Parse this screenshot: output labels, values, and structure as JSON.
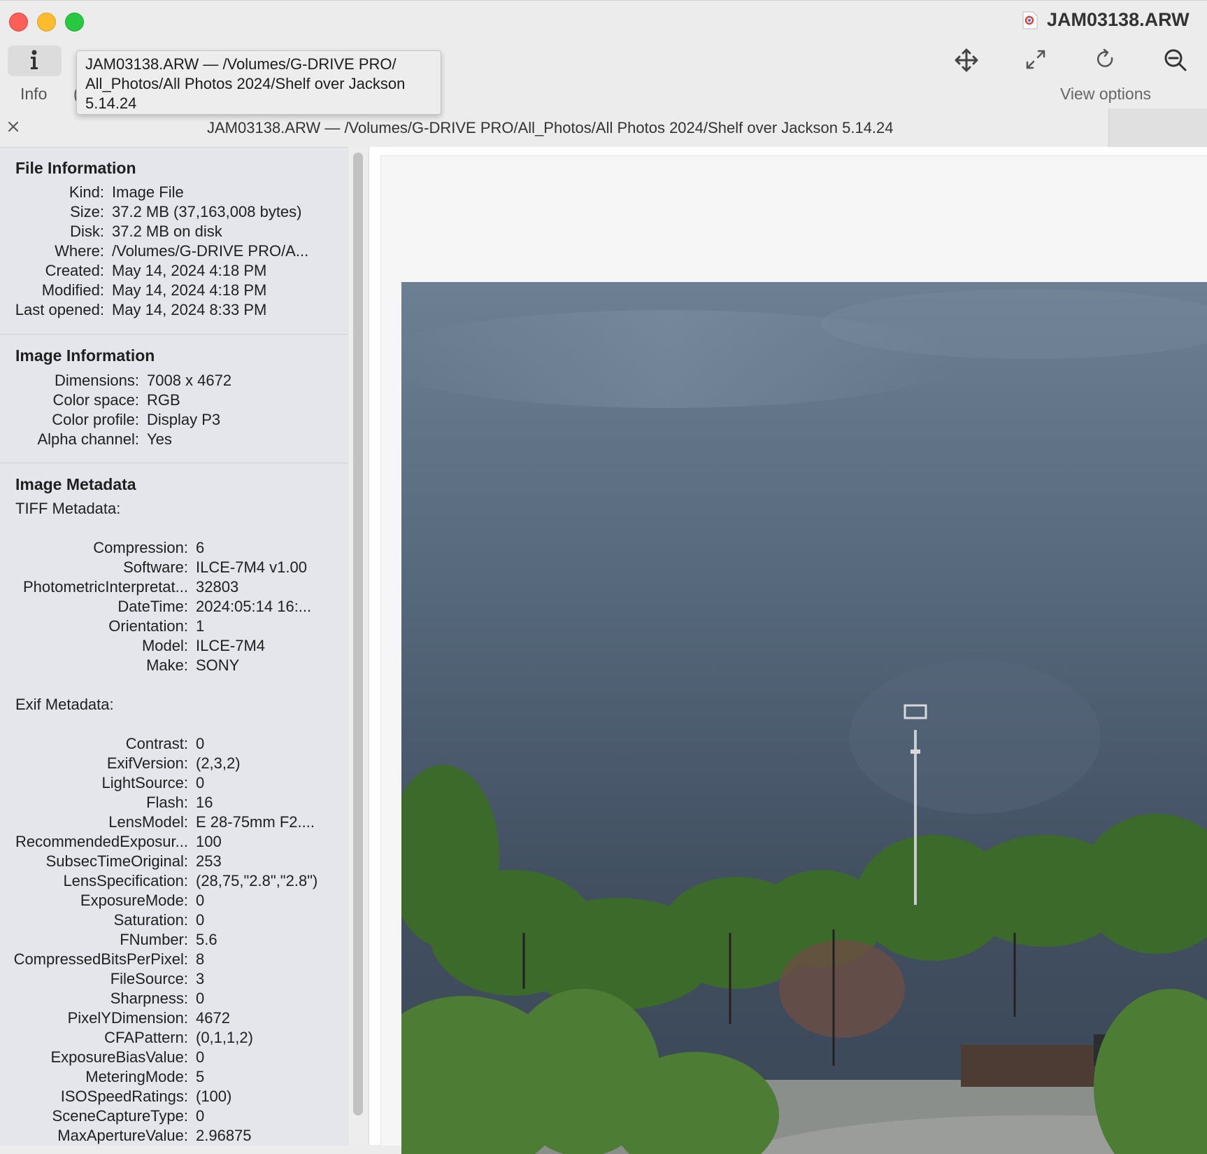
{
  "window": {
    "title": "JAM03138.ARW"
  },
  "toolbar": {
    "info_label": "Info",
    "hidden_item_char": "(",
    "view_options_label": "View options",
    "icons": [
      "info-icon",
      "move-icon",
      "fullscreen-icon",
      "rotate-icon",
      "zoom-out-icon"
    ]
  },
  "tooltip": {
    "text": "JAM03138.ARW — /Volumes/G-DRIVE PRO/ All_Photos/All Photos 2024/Shelf over Jackson 5.14.24"
  },
  "tab": {
    "title": "JAM03138.ARW  —  /Volumes/G-DRIVE PRO/All_Photos/All Photos 2024/Shelf over Jackson 5.14.24"
  },
  "inspector": {
    "file_information": {
      "title": "File Information",
      "rows": [
        {
          "key": "Kind:",
          "value": "Image File"
        },
        {
          "key": "Size:",
          "value": "37.2 MB (37,163,008 bytes)"
        },
        {
          "key": "Disk:",
          "value": "37.2 MB on disk"
        },
        {
          "key": "Where:",
          "value": "/Volumes/G-DRIVE PRO/A..."
        },
        {
          "key": "Created:",
          "value": "May 14, 2024 4:18 PM"
        },
        {
          "key": "Modified:",
          "value": "May 14, 2024 4:18 PM"
        },
        {
          "key": "Last opened:",
          "value": "May 14, 2024 8:33 PM"
        }
      ]
    },
    "image_information": {
      "title": "Image Information",
      "rows": [
        {
          "key": "Dimensions:",
          "value": "7008 x 4672"
        },
        {
          "key": "Color space:",
          "value": "RGB"
        },
        {
          "key": "Color profile:",
          "value": "Display P3"
        },
        {
          "key": "Alpha channel:",
          "value": "Yes"
        }
      ]
    },
    "image_metadata": {
      "title": "Image Metadata",
      "tiff_label": "TIFF Metadata:",
      "tiff_rows": [
        {
          "key": "Compression:",
          "value": "6"
        },
        {
          "key": "Software:",
          "value": "ILCE-7M4 v1.00"
        },
        {
          "key": "PhotometricInterpretat...",
          "value": "32803"
        },
        {
          "key": "DateTime:",
          "value": "2024:05:14 16:..."
        },
        {
          "key": "Orientation:",
          "value": "1"
        },
        {
          "key": "Model:",
          "value": "ILCE-7M4"
        },
        {
          "key": "Make:",
          "value": "SONY"
        }
      ],
      "exif_label": "Exif Metadata:",
      "exif_rows": [
        {
          "key": "Contrast:",
          "value": "0"
        },
        {
          "key": "ExifVersion:",
          "value": "(2,3,2)"
        },
        {
          "key": "LightSource:",
          "value": "0"
        },
        {
          "key": "Flash:",
          "value": "16"
        },
        {
          "key": "LensModel:",
          "value": "E 28-75mm F2...."
        },
        {
          "key": "RecommendedExposur...",
          "value": "100"
        },
        {
          "key": "SubsecTimeOriginal:",
          "value": "253"
        },
        {
          "key": "LensSpecification:",
          "value": "(28,75,\"2.8\",\"2.8\")"
        },
        {
          "key": "ExposureMode:",
          "value": "0"
        },
        {
          "key": "Saturation:",
          "value": "0"
        },
        {
          "key": "FNumber:",
          "value": "5.6"
        },
        {
          "key": "CompressedBitsPerPixel:",
          "value": "8"
        },
        {
          "key": "FileSource:",
          "value": "3"
        },
        {
          "key": "Sharpness:",
          "value": "0"
        },
        {
          "key": "PixelYDimension:",
          "value": "4672"
        },
        {
          "key": "CFAPattern:",
          "value": "(0,1,1,2)"
        },
        {
          "key": "ExposureBiasValue:",
          "value": "0"
        },
        {
          "key": "MeteringMode:",
          "value": "5"
        },
        {
          "key": "ISOSpeedRatings:",
          "value": "(100)"
        },
        {
          "key": "SceneCaptureType:",
          "value": "0"
        },
        {
          "key": "MaxApertureValue:",
          "value": "2.96875"
        }
      ]
    }
  },
  "colors": {
    "close": "#fe5f57",
    "minimize": "#febc2e",
    "zoom": "#28c840",
    "inspector_bg": "#e4e6eb",
    "sky": "#4f6074",
    "foliage": "#3f6a2c"
  }
}
